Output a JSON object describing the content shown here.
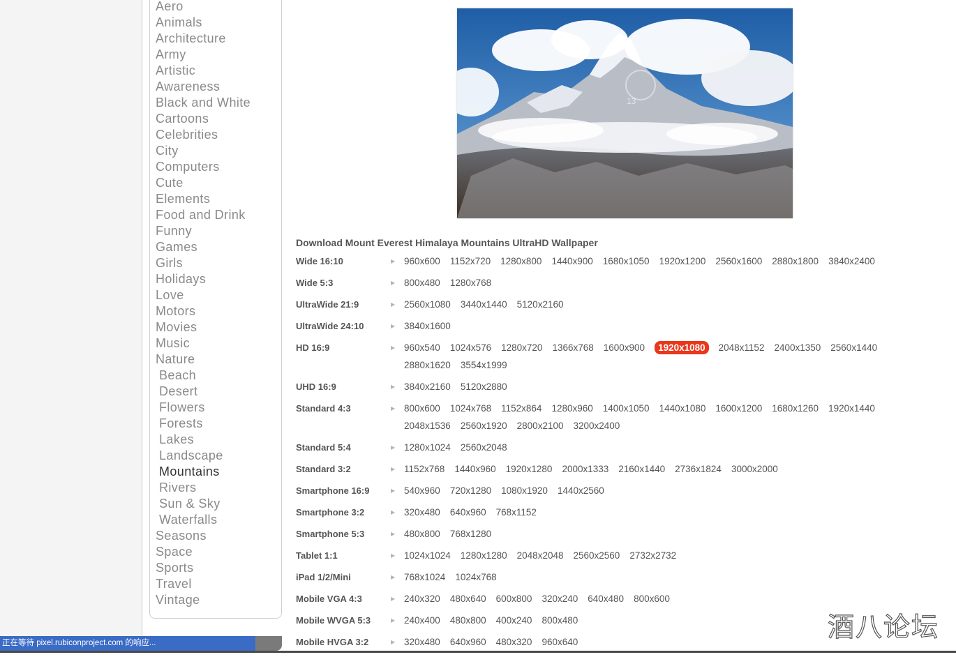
{
  "sidebar": {
    "categories": [
      {
        "label": "Aero"
      },
      {
        "label": "Animals"
      },
      {
        "label": "Architecture"
      },
      {
        "label": "Army"
      },
      {
        "label": "Artistic"
      },
      {
        "label": "Awareness"
      },
      {
        "label": "Black and White"
      },
      {
        "label": "Cartoons"
      },
      {
        "label": "Celebrities"
      },
      {
        "label": "City"
      },
      {
        "label": "Computers"
      },
      {
        "label": "Cute"
      },
      {
        "label": "Elements"
      },
      {
        "label": "Food and Drink"
      },
      {
        "label": "Funny"
      },
      {
        "label": "Games"
      },
      {
        "label": "Girls"
      },
      {
        "label": "Holidays"
      },
      {
        "label": "Love"
      },
      {
        "label": "Motors"
      },
      {
        "label": "Movies"
      },
      {
        "label": "Music"
      },
      {
        "label": "Nature"
      },
      {
        "label": "Beach",
        "sub": true
      },
      {
        "label": "Desert",
        "sub": true
      },
      {
        "label": "Flowers",
        "sub": true
      },
      {
        "label": "Forests",
        "sub": true
      },
      {
        "label": "Lakes",
        "sub": true
      },
      {
        "label": "Landscape",
        "sub": true
      },
      {
        "label": "Mountains",
        "sub": true,
        "active": true
      },
      {
        "label": "Rivers",
        "sub": true
      },
      {
        "label": "Sun & Sky",
        "sub": true
      },
      {
        "label": "Waterfalls",
        "sub": true
      },
      {
        "label": "Seasons"
      },
      {
        "label": "Space"
      },
      {
        "label": "Sports"
      },
      {
        "label": "Travel"
      },
      {
        "label": "Vintage"
      }
    ]
  },
  "preview": {
    "overlay_number": "13"
  },
  "downloads": {
    "heading": "Download Mount Everest Himalaya Mountains UltraHD Wallpaper",
    "highlight_color": "#e8371b",
    "groups": [
      {
        "label": "Wide 16:10",
        "items": [
          "960x600",
          "1152x720",
          "1280x800",
          "1440x900",
          "1680x1050",
          "1920x1200",
          "2560x1600",
          "2880x1800",
          "3840x2400"
        ]
      },
      {
        "label": "Wide 5:3",
        "items": [
          "800x480",
          "1280x768"
        ]
      },
      {
        "label": "UltraWide 21:9",
        "items": [
          "2560x1080",
          "3440x1440",
          "5120x2160"
        ]
      },
      {
        "label": "UltraWide 24:10",
        "items": [
          "3840x1600"
        ]
      },
      {
        "label": "HD 16:9",
        "items": [
          "960x540",
          "1024x576",
          "1280x720",
          "1366x768",
          "1600x900",
          "1920x1080",
          "2048x1152",
          "2400x1350",
          "2560x1440",
          "2880x1620",
          "3554x1999"
        ],
        "highlight": "1920x1080"
      },
      {
        "label": "UHD 16:9",
        "items": [
          "3840x2160",
          "5120x2880"
        ]
      },
      {
        "label": "Standard 4:3",
        "items": [
          "800x600",
          "1024x768",
          "1152x864",
          "1280x960",
          "1400x1050",
          "1440x1080",
          "1600x1200",
          "1680x1260",
          "1920x1440",
          "2048x1536",
          "2560x1920",
          "2800x2100",
          "3200x2400"
        ]
      },
      {
        "label": "Standard 5:4",
        "items": [
          "1280x1024",
          "2560x2048"
        ]
      },
      {
        "label": "Standard 3:2",
        "items": [
          "1152x768",
          "1440x960",
          "1920x1280",
          "2000x1333",
          "2160x1440",
          "2736x1824",
          "3000x2000"
        ]
      },
      {
        "label": "Smartphone 16:9",
        "items": [
          "540x960",
          "720x1280",
          "1080x1920",
          "1440x2560"
        ]
      },
      {
        "label": "Smartphone 3:2",
        "items": [
          "320x480",
          "640x960",
          "768x1152"
        ]
      },
      {
        "label": "Smartphone 5:3",
        "items": [
          "480x800",
          "768x1280"
        ]
      },
      {
        "label": "Tablet 1:1",
        "items": [
          "1024x1024",
          "1280x1280",
          "2048x2048",
          "2560x2560",
          "2732x2732"
        ]
      },
      {
        "label": "iPad 1/2/Mini",
        "items": [
          "768x1024",
          "1024x768"
        ]
      },
      {
        "label": "Mobile VGA 4:3",
        "items": [
          "240x320",
          "480x640",
          "600x800",
          "320x240",
          "640x480",
          "800x600"
        ]
      },
      {
        "label": "Mobile WVGA 5:3",
        "items": [
          "240x400",
          "480x800",
          "400x240",
          "800x480"
        ]
      },
      {
        "label": "Mobile HVGA 3:2",
        "items": [
          "320x480",
          "640x960",
          "480x320",
          "960x640"
        ]
      }
    ]
  },
  "status_bar": {
    "text": "正在等待 pixel.rubiconproject.com 的响应..."
  },
  "watermark": {
    "text": "酒八论坛"
  }
}
